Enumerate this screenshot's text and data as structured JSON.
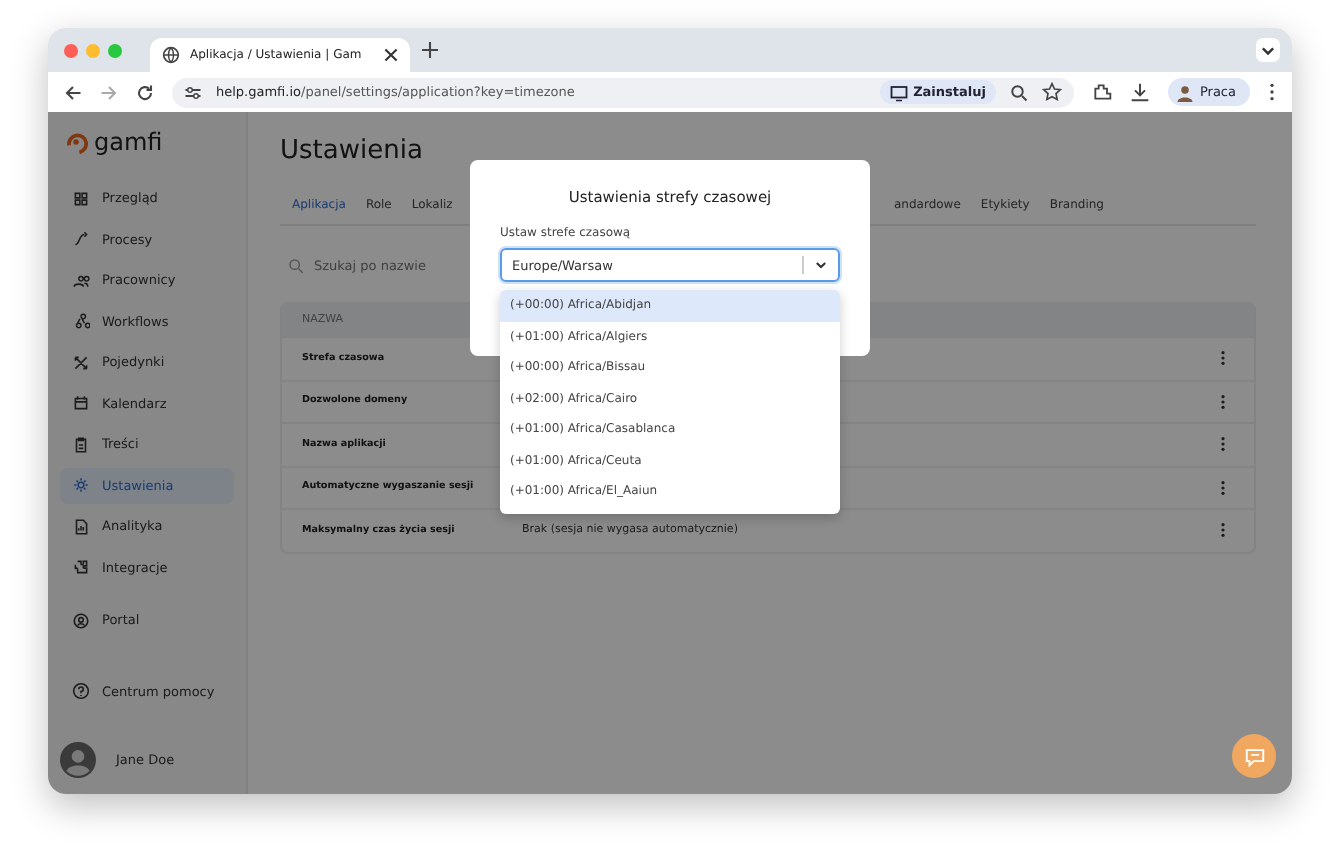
{
  "browser": {
    "tab_title": "Aplikacja / Ustawienia | Gam",
    "url_host": "help.gamfi.io",
    "url_path": "/panel/settings/application?key=timezone",
    "install_label": "Zainstaluj",
    "profile_label": "Praca"
  },
  "sidebar": {
    "logo": "gamfi",
    "items": [
      {
        "label": "Przegląd",
        "selected": false
      },
      {
        "label": "Procesy",
        "selected": false
      },
      {
        "label": "Pracownicy",
        "selected": false
      },
      {
        "label": "Workflows",
        "selected": false
      },
      {
        "label": "Pojedynki",
        "selected": false
      },
      {
        "label": "Kalendarz",
        "selected": false
      },
      {
        "label": "Treści",
        "selected": false
      },
      {
        "label": "Ustawienia",
        "selected": true
      },
      {
        "label": "Analityka",
        "selected": false
      },
      {
        "label": "Integracje",
        "selected": false
      },
      {
        "label": "Portal",
        "selected": false
      }
    ],
    "help": "Centrum pomocy",
    "user": "Jane Doe"
  },
  "page": {
    "title": "Ustawienia",
    "tabs_left": [
      {
        "label": "Aplikacja",
        "selected": true
      },
      {
        "label": "Role",
        "selected": false
      },
      {
        "label": "Lokaliz",
        "selected": false
      }
    ],
    "tabs_right": [
      {
        "label": "andardowe",
        "selected": false
      },
      {
        "label": "Etykiety",
        "selected": false
      },
      {
        "label": "Branding",
        "selected": false
      }
    ],
    "search": {
      "placeholder": "Szukaj po nazwie"
    },
    "table": {
      "columns": [
        "NAZWA"
      ],
      "rows": [
        {
          "name": "Strefa czasowa",
          "value": ""
        },
        {
          "name": "Dozwolone domeny",
          "value": ""
        },
        {
          "name": "Nazwa aplikacji",
          "value": ""
        },
        {
          "name": "Automatyczne wygaszanie sesji",
          "value": ""
        },
        {
          "name": "Maksymalny czas życia sesji",
          "value": "Brak (sesja nie wygasa automatycznie)"
        }
      ]
    }
  },
  "modal": {
    "title": "Ustawienia strefy czasowej",
    "field_label": "Ustaw strefe czasową",
    "value": "Europe/Warsaw",
    "options": [
      {
        "label": "(+00:00) Africa/Abidjan",
        "selected": true
      },
      {
        "label": "(+01:00) Africa/Algiers",
        "selected": false
      },
      {
        "label": "(+00:00) Africa/Bissau",
        "selected": false
      },
      {
        "label": "(+02:00) Africa/Cairo",
        "selected": false
      },
      {
        "label": "(+01:00) Africa/Casablanca",
        "selected": false
      },
      {
        "label": "(+01:00) Africa/Ceuta",
        "selected": false
      },
      {
        "label": "(+01:00) Africa/El_Aaiun",
        "selected": false
      }
    ]
  }
}
